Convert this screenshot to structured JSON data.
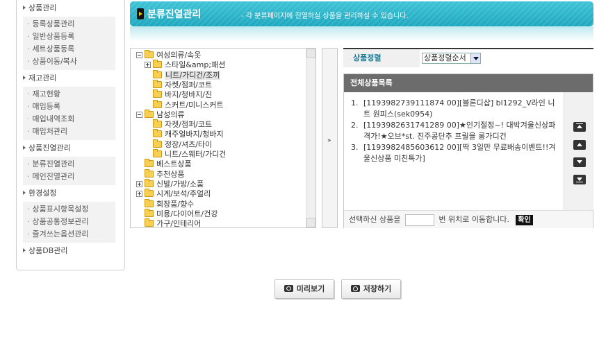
{
  "sidebar": {
    "groups": [
      {
        "label": "상품관리",
        "items": [
          "등록상품관리",
          "일반상품등록",
          "세트상품등록",
          "상품이동/복사"
        ]
      },
      {
        "label": "재고관리",
        "items": [
          "재고현황",
          "매입등록",
          "매입내역조회",
          "매입처관리"
        ]
      },
      {
        "label": "상품진열관리",
        "items": [
          "분류진열관리",
          "메인진열관리"
        ]
      },
      {
        "label": "환경설정",
        "items": [
          "상품표시항목설정",
          "상품공통정보관리",
          "즐겨쓰는옵션관리"
        ]
      },
      {
        "label": "상품DB관리",
        "items": []
      }
    ]
  },
  "banner": {
    "title": "분류진열관리",
    "description": "- 각 분류페이지에 진열하실 상품을 관리하실 수 있습니다."
  },
  "tree": {
    "nodes": [
      {
        "label": "여성의류/속옷",
        "level": 0,
        "toggle": "minus"
      },
      {
        "label": "스타일&amp;패션",
        "level": 1,
        "toggle": "plus"
      },
      {
        "label": "니트/가디건/조끼",
        "level": 1,
        "toggle": "",
        "selected": true
      },
      {
        "label": "자켓/점퍼/코트",
        "level": 1,
        "toggle": ""
      },
      {
        "label": "바지/청바지/진",
        "level": 1,
        "toggle": ""
      },
      {
        "label": "스커트/미니스커트",
        "level": 1,
        "toggle": ""
      },
      {
        "label": "남성의류",
        "level": 0,
        "toggle": "minus"
      },
      {
        "label": "자켓/점퍼/코트",
        "level": 1,
        "toggle": ""
      },
      {
        "label": "캐주얼바지/청바지",
        "level": 1,
        "toggle": ""
      },
      {
        "label": "정장/셔츠/타이",
        "level": 1,
        "toggle": ""
      },
      {
        "label": "니트/스웨터/가디건",
        "level": 1,
        "toggle": ""
      },
      {
        "label": "베스트상품",
        "level": 0,
        "toggle": ""
      },
      {
        "label": "추천상품",
        "level": 0,
        "toggle": ""
      },
      {
        "label": "신발/가방/소품",
        "level": 0,
        "toggle": "plus"
      },
      {
        "label": "시계/보석/주얼리",
        "level": 0,
        "toggle": "plus"
      },
      {
        "label": "회장품/향수",
        "level": 0,
        "toggle": ""
      },
      {
        "label": "미용/다이어트/건강",
        "level": 0,
        "toggle": ""
      },
      {
        "label": "가구/인테리어",
        "level": 0,
        "toggle": ""
      }
    ]
  },
  "mover": {
    "arrow": "»"
  },
  "sort": {
    "label": "상품정렬",
    "selected": "상품정렬순서"
  },
  "product_list": {
    "title": "전체상품목록",
    "items": [
      {
        "num": "1.",
        "text": "[1193982739111874 00][블론디샵] bl1292_V라인 니트 원피스(sek0954)"
      },
      {
        "num": "2.",
        "text": "[1193982631741289 00]★인기절정~! 대박겨울신상파격가!★오브*st. 진주콩단추 프릴을 롱가디건"
      },
      {
        "num": "3.",
        "text": "[1193982485603612 00][딱 3일만 무료배송이벤트!!겨울신상품 미친특가]"
      }
    ],
    "footer_prefix": "선택하신 상품을",
    "footer_suffix": "번 위치로 이동합니다.",
    "confirm": "확인"
  },
  "buttons": {
    "preview": "미리보기",
    "save": "저장하기"
  }
}
